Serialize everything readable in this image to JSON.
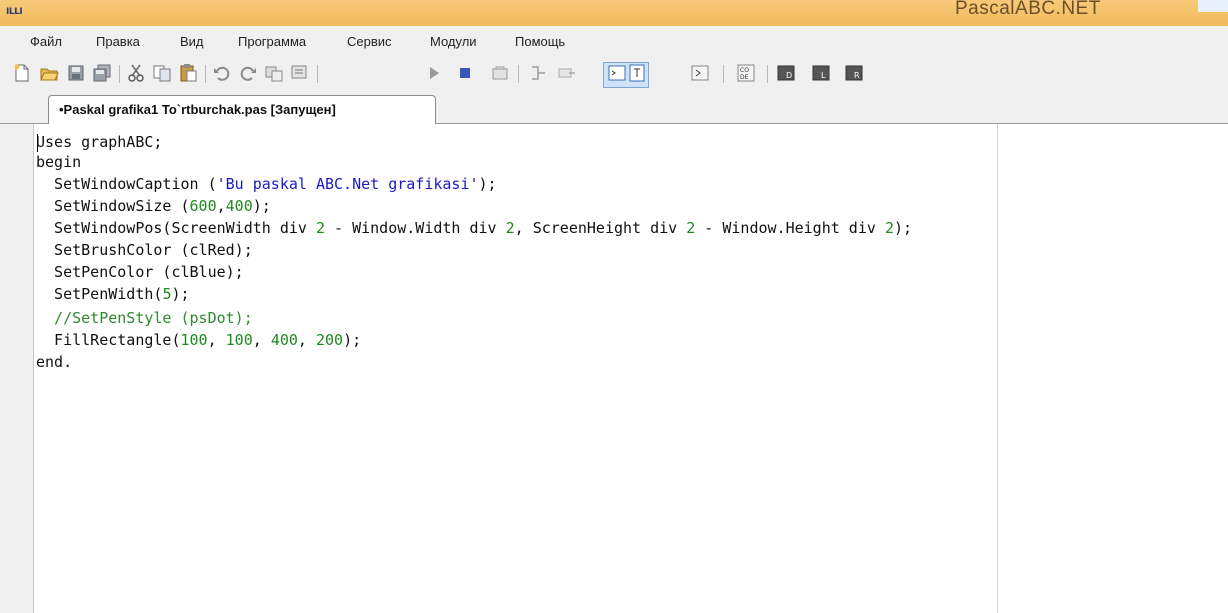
{
  "window": {
    "app_icon_text": "ILLI",
    "title": "PascalABC.NET"
  },
  "menu": [
    "Файл",
    "Правка",
    "Вид",
    "Программа",
    "Сервис",
    "Модули",
    "Помощь"
  ],
  "toolbar_icons": [
    "new-file-icon",
    "open-folder-icon",
    "save-icon",
    "save-all-icon",
    "cut-icon",
    "copy-icon",
    "paste-icon",
    "undo-icon",
    "redo-icon",
    "find-icon",
    "replace-icon",
    "run-icon",
    "stop-icon",
    "compile-icon",
    "debug-step-icon",
    "debug-step-over-icon",
    "output-window-icon",
    "form-window-icon",
    "debug-window-icon",
    "code-template-icon",
    "wizard-d-icon",
    "wizard-l-icon",
    "wizard-r-icon"
  ],
  "tab": {
    "label": "•Paskal grafika1 To`rtburchak.pas [Запущен]"
  },
  "code": {
    "line1": "Uses graphABC;",
    "line2": "begin",
    "line3a": "  SetWindowCaption (",
    "line3str": "'Bu paskal ABC.Net grafikasi'",
    "line3b": ");",
    "line4a": "  SetWindowSize (",
    "line4n1": "600",
    "line4c": ",",
    "line4n2": "400",
    "line4b": ");",
    "line5a": "  SetWindowPos(ScreenWidth div ",
    "line5n1": "2",
    "line5b": " - Window.Width div ",
    "line5n2": "2",
    "line5c": ", ScreenHeight div ",
    "line5n3": "2",
    "line5d": " - Window.Height div ",
    "line5n4": "2",
    "line5e": ");",
    "line6": "  SetBrushColor (clRed);",
    "line7": "  SetPenColor (clBlue);",
    "line8a": "  SetPenWidth(",
    "line8n": "5",
    "line8b": ");",
    "line9": "  //SetPenStyle (psDot);",
    "line10a": "  FillRectangle(",
    "line10n1": "100",
    "line10c1": ", ",
    "line10n2": "100",
    "line10c2": ", ",
    "line10n3": "400",
    "line10c3": ", ",
    "line10n4": "200",
    "line10b": ");",
    "line11": "end."
  },
  "colors": {
    "string": "#1a1ac8",
    "number": "#1f8a1f",
    "comment": "#2e8b2e",
    "keyword": "#000000"
  }
}
